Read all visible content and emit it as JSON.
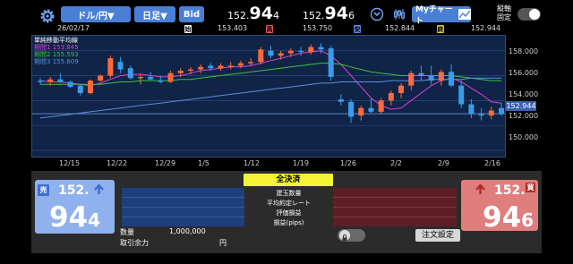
{
  "header": {
    "pair_label": "ドル/円▼",
    "period_label": "日足▼",
    "bid_label": "Bid",
    "price1_small": "152.",
    "price1_big": "94",
    "price1_tail": "4",
    "price2_small": "152.",
    "price2_big": "94",
    "price2_tail": "6",
    "my_chart_label": "Myチャート",
    "toggle_label_line1": "縦軸",
    "toggle_label_line2": "固定"
  },
  "ohlc": {
    "date": "26/02/17",
    "open_tag": "始",
    "open": "153.403",
    "high_tag": "高",
    "high": "153.750",
    "low_tag": "安",
    "low": "152.844",
    "close_tag": "終",
    "close": "152.944"
  },
  "legend": {
    "title": "単純移動平均線",
    "items": [
      {
        "label": "期間1",
        "value": "153.845",
        "color": "#e040e0"
      },
      {
        "label": "期間2",
        "value": "155.593",
        "color": "#3ac43a"
      },
      {
        "label": "期間3",
        "value": "155.809",
        "color": "#5a8ee0"
      }
    ]
  },
  "chart_data": {
    "type": "candlestick",
    "ylim": [
      149.5,
      159.2
    ],
    "y_ticks": [
      "158.000",
      "156.000",
      "154.000",
      "152.000",
      "150.000"
    ],
    "x_ticks": [
      "12/15",
      "12/22",
      "12/29",
      "1/5",
      "1/12",
      "1/19",
      "1/26",
      "2/2",
      "2/9",
      "2/16"
    ],
    "current_price": "152.944",
    "candles": [
      [
        155.6,
        155.8,
        155.3,
        155.5
      ],
      [
        155.5,
        155.9,
        155.2,
        155.7
      ],
      [
        155.7,
        156.2,
        155.4,
        155.5
      ],
      [
        155.5,
        155.6,
        155.0,
        155.1
      ],
      [
        155.2,
        155.3,
        154.4,
        154.6
      ],
      [
        154.6,
        155.7,
        154.5,
        155.6
      ],
      [
        155.6,
        156.1,
        155.5,
        156.0
      ],
      [
        156.0,
        157.6,
        155.8,
        157.4
      ],
      [
        157.1,
        157.5,
        156.2,
        156.5
      ],
      [
        156.6,
        156.8,
        155.7,
        155.8
      ],
      [
        155.8,
        156.2,
        155.3,
        155.9
      ],
      [
        155.9,
        156.3,
        155.6,
        155.7
      ],
      [
        155.6,
        156.0,
        155.4,
        155.5
      ],
      [
        155.5,
        156.4,
        155.4,
        156.2
      ],
      [
        156.2,
        156.6,
        155.9,
        156.4
      ],
      [
        156.4,
        156.7,
        156.1,
        156.5
      ],
      [
        156.5,
        156.9,
        156.2,
        156.7
      ],
      [
        156.8,
        157.0,
        156.4,
        156.6
      ],
      [
        156.6,
        157.0,
        156.4,
        156.8
      ],
      [
        156.7,
        157.1,
        156.5,
        156.8
      ],
      [
        156.8,
        157.2,
        156.6,
        157.0
      ],
      [
        157.0,
        157.4,
        156.8,
        157.1
      ],
      [
        157.1,
        158.3,
        156.9,
        158.1
      ],
      [
        158.0,
        158.4,
        157.4,
        157.6
      ],
      [
        157.6,
        158.0,
        157.3,
        157.8
      ],
      [
        157.8,
        158.2,
        157.5,
        158.0
      ],
      [
        158.0,
        158.3,
        157.6,
        157.9
      ],
      [
        157.9,
        158.5,
        157.7,
        158.3
      ],
      [
        158.3,
        158.6,
        157.8,
        158.1
      ],
      [
        158.2,
        158.4,
        155.6,
        155.9
      ],
      [
        154.1,
        154.5,
        153.6,
        153.9
      ],
      [
        153.9,
        154.1,
        152.2,
        152.7
      ],
      [
        152.8,
        153.6,
        152.4,
        153.4
      ],
      [
        153.4,
        154.2,
        153.0,
        153.1
      ],
      [
        153.1,
        154.2,
        152.9,
        154.0
      ],
      [
        154.0,
        154.8,
        153.6,
        154.6
      ],
      [
        154.6,
        155.4,
        154.2,
        155.2
      ],
      [
        155.2,
        156.4,
        154.8,
        156.2
      ],
      [
        156.2,
        156.8,
        155.6,
        156.0
      ],
      [
        156.0,
        156.8,
        155.3,
        155.6
      ],
      [
        155.6,
        156.5,
        155.2,
        156.3
      ],
      [
        156.3,
        156.9,
        155.1,
        155.2
      ],
      [
        155.2,
        155.6,
        153.4,
        153.7
      ],
      [
        153.7,
        154.1,
        152.6,
        152.9
      ],
      [
        152.9,
        153.4,
        152.4,
        152.8
      ],
      [
        152.8,
        153.5,
        152.5,
        153.2
      ],
      [
        153.4,
        153.8,
        152.8,
        152.9
      ]
    ],
    "series": [
      {
        "name": "期間1",
        "color": "#e040e0",
        "values": [
          155.6,
          155.5,
          155.5,
          155.4,
          155.3,
          155.2,
          155.4,
          155.7,
          156.0,
          156.1,
          156.1,
          156.0,
          155.9,
          155.9,
          156.0,
          156.2,
          156.4,
          156.5,
          156.6,
          156.7,
          156.7,
          156.8,
          157.0,
          157.2,
          157.4,
          157.6,
          157.8,
          157.9,
          158.0,
          157.6,
          156.9,
          156.0,
          155.1,
          154.2,
          153.6,
          153.3,
          153.4,
          154.0,
          154.6,
          155.2,
          155.6,
          155.8,
          155.5,
          155.0,
          154.5,
          153.9,
          153.8
        ]
      },
      {
        "name": "期間2",
        "color": "#3ac43a",
        "values": [
          155.3,
          155.3,
          155.3,
          155.3,
          155.3,
          155.3,
          155.3,
          155.4,
          155.5,
          155.5,
          155.6,
          155.6,
          155.6,
          155.6,
          155.7,
          155.7,
          155.8,
          155.9,
          156.0,
          156.1,
          156.2,
          156.3,
          156.4,
          156.5,
          156.6,
          156.7,
          156.8,
          156.9,
          157.0,
          157.0,
          156.9,
          156.7,
          156.5,
          156.3,
          156.2,
          156.1,
          156.0,
          156.0,
          156.0,
          156.0,
          156.0,
          156.0,
          155.9,
          155.8,
          155.7,
          155.6,
          155.6
        ]
      },
      {
        "name": "期間3",
        "color": "#5a8ee0",
        "values": [
          152.6,
          152.7,
          152.8,
          152.9,
          153.0,
          153.1,
          153.2,
          153.3,
          153.4,
          153.5,
          153.6,
          153.7,
          153.8,
          153.9,
          154.0,
          154.1,
          154.2,
          154.3,
          154.4,
          154.5,
          154.6,
          154.7,
          154.8,
          154.9,
          155.0,
          155.1,
          155.2,
          155.3,
          155.4,
          155.4,
          155.5,
          155.5,
          155.5,
          155.5,
          155.5,
          155.6,
          155.6,
          155.6,
          155.6,
          155.7,
          155.7,
          155.7,
          155.7,
          155.8,
          155.8,
          155.8,
          155.8
        ]
      }
    ]
  },
  "trade": {
    "sell_tag": "売",
    "sell_small": "152.",
    "sell_big": "94",
    "sell_tail": "4",
    "buy_tag": "買",
    "buy_small": "152.",
    "buy_big": "94",
    "buy_tail": "6",
    "close_all_label": "全決済",
    "rows": [
      "建玉数量",
      "平均約定レート",
      "評価損益",
      "損益(pips)"
    ],
    "quantity_label": "数量",
    "quantity_value": "1,000,000",
    "margin_label": "取引余力",
    "margin_unit": "円",
    "order_settings_label": "注文設定"
  }
}
